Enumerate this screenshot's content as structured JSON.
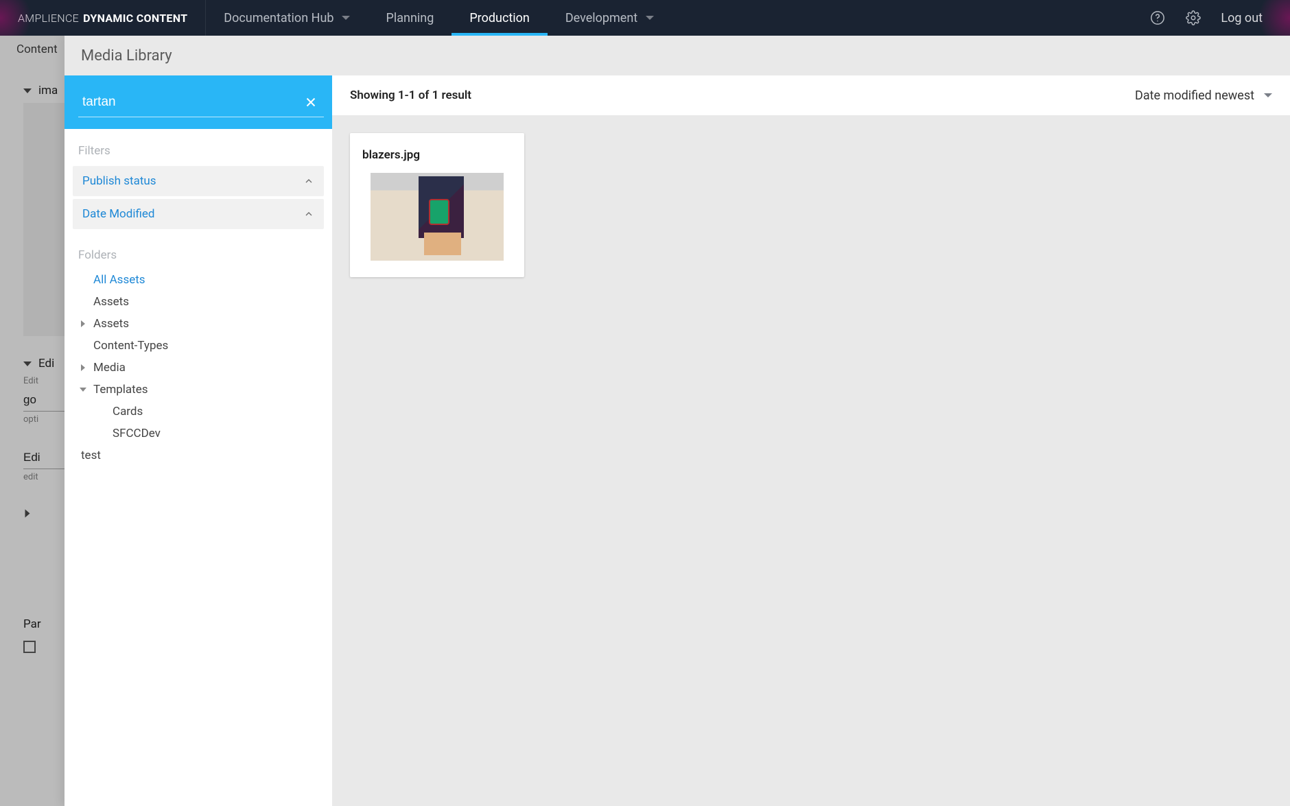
{
  "brand": {
    "light": "AMPLIENCE",
    "bold": "DYNAMIC CONTENT"
  },
  "topnav": {
    "items": [
      {
        "label": "Documentation Hub",
        "hasCaret": true,
        "active": false
      },
      {
        "label": "Planning",
        "hasCaret": false,
        "active": false
      },
      {
        "label": "Production",
        "hasCaret": false,
        "active": true
      },
      {
        "label": "Development",
        "hasCaret": true,
        "active": false
      }
    ],
    "logout": "Log out"
  },
  "underlay": {
    "subheader": "Content",
    "section_image": "ima",
    "section_edit": "Edi",
    "field1_label": "Edit",
    "field1_value": "go",
    "field1_hint": "opti",
    "field2_value": "Edi",
    "field2_hint": "edit",
    "params_label": "Par"
  },
  "modal": {
    "title": "Media Library",
    "search": {
      "value": "tartan"
    },
    "filters": {
      "label": "Filters",
      "publish_status": "Publish status",
      "date_modified": "Date Modified"
    },
    "folders": {
      "label": "Folders",
      "all_assets": "All Assets",
      "items": [
        {
          "label": "Assets",
          "expandable": false
        },
        {
          "label": "Assets",
          "expandable": true,
          "open": false
        },
        {
          "label": "Content-Types",
          "expandable": false
        },
        {
          "label": "Media",
          "expandable": true,
          "open": false
        },
        {
          "label": "Templates",
          "expandable": true,
          "open": true,
          "children": [
            "Cards",
            "SFCCDev"
          ]
        }
      ],
      "root_extra": "test"
    },
    "results": {
      "count_text": "Showing 1-1 of 1 result",
      "sort_label": "Date modified newest",
      "cards": [
        {
          "title": "blazers.jpg"
        }
      ]
    }
  }
}
